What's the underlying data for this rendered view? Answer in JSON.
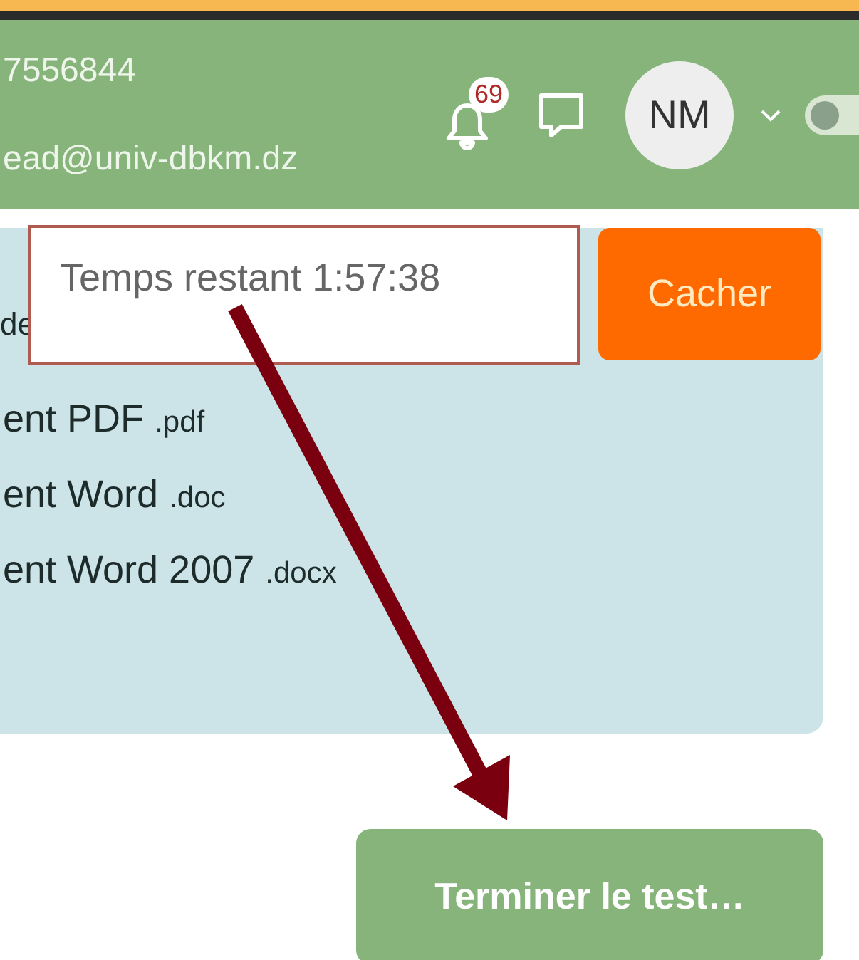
{
  "header": {
    "phone": "7556844",
    "email": "ead@univ-dbkm.dz",
    "notification_count": "69",
    "avatar_initials": "NM",
    "toggle": {
      "on": false
    }
  },
  "card": {
    "label": "de",
    "files": [
      {
        "name": "ent PDF",
        "ext": ".pdf"
      },
      {
        "name": "ent Word",
        "ext": ".doc"
      },
      {
        "name": "ent Word 2007",
        "ext": ".docx"
      }
    ]
  },
  "timer": {
    "text": "Temps restant 1:57:38"
  },
  "hide_button": "Cacher",
  "finish_button": "Terminer le test…"
}
